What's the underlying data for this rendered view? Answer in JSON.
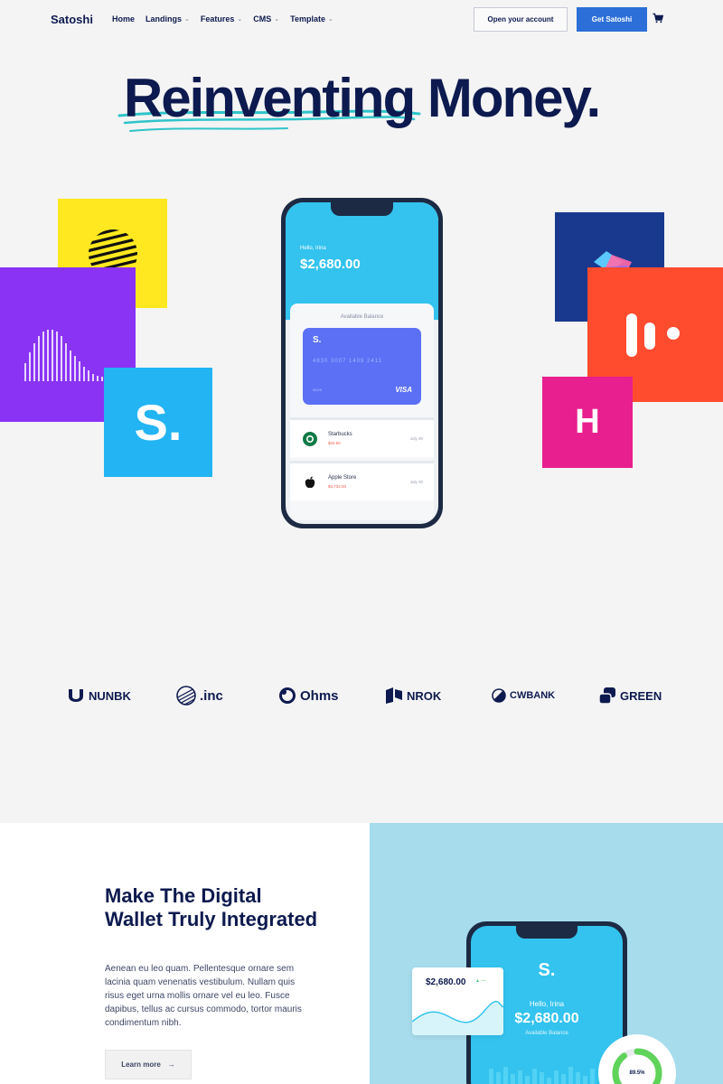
{
  "nav": {
    "brand": "Satoshi",
    "menu": [
      {
        "label": "Home",
        "dropdown": false
      },
      {
        "label": "Landings",
        "dropdown": true
      },
      {
        "label": "Features",
        "dropdown": true
      },
      {
        "label": "CMS",
        "dropdown": true
      },
      {
        "label": "Template",
        "dropdown": true
      }
    ],
    "open_account": "Open your account",
    "get_satoshi": "Get Satoshi",
    "cart_icon": "cart-icon"
  },
  "hero": {
    "title": "Reinventing Money.",
    "accent_scribble": "#2ec4c9",
    "tile_blue_letter": "S.",
    "tile_pink_letter": "H"
  },
  "phone": {
    "greeting": "Hello, Irina",
    "balance": "$2,680.00",
    "available_label": "Available Balance",
    "card": {
      "logo": "S.",
      "number": "4830  3007  1409  2411",
      "expiry": "05/25",
      "brand": "VISA"
    },
    "transactions": [
      {
        "name": "Starbucks",
        "amount": "$34.50",
        "date": "July 30",
        "icon": "starbucks-icon"
      },
      {
        "name": "Apple Store",
        "amount": "$3,734.50",
        "date": "July 30",
        "icon": "apple-icon"
      }
    ]
  },
  "partners": [
    "NUNBK",
    ".inc",
    "Ohms",
    "NROK",
    "CWBANK",
    "GREEN"
  ],
  "section": {
    "title": "Make The Digital Wallet Truly Integrated",
    "body": "Aenean eu leo quam. Pellentesque ornare sem lacinia quam venenatis vestibulum. Nullam quis risus eget urna mollis ornare vel eu leo. Fusce dapibus, tellus ac cursus commodo, tortor mauris condimentum nibh.",
    "learn_more": "Learn more"
  },
  "phone2": {
    "logo": "S.",
    "greeting": "Hello, Irina",
    "balance": "$2,680.00",
    "available_label": "Available Balance"
  },
  "stat_card": {
    "value": "$2,680.00"
  },
  "donut": {
    "percent_label": "89.5%",
    "percent": 0.895,
    "color": "#5fd35a"
  },
  "colors": {
    "navy": "#0d1a4f",
    "primary_button": "#2d6fd8",
    "yellow": "#ffe81f",
    "purple": "#8a33f4",
    "sky": "#23b4f4",
    "royal": "#18398e",
    "red": "#ff4b2e",
    "pink": "#e81f8e",
    "light_blue_panel": "#a6dcec"
  }
}
